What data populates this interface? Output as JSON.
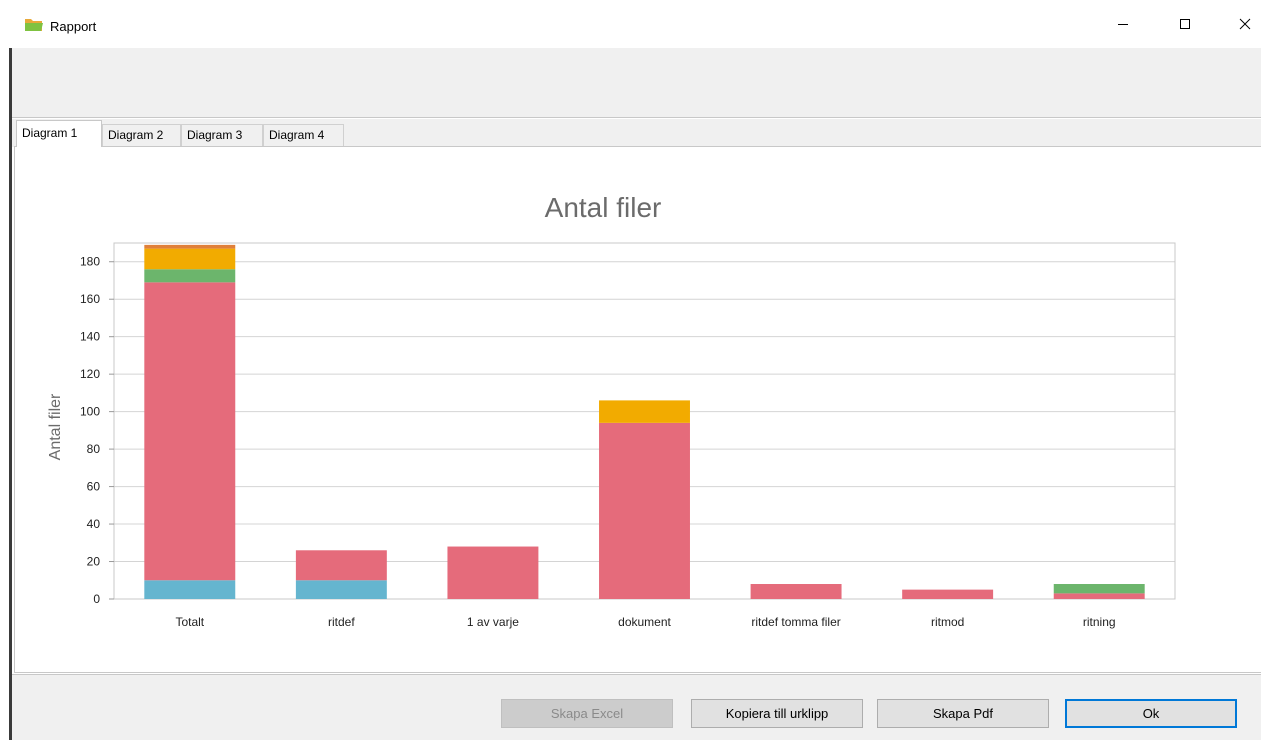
{
  "window": {
    "title": "Rapport",
    "app_icon": "folder-icon"
  },
  "tabs": [
    {
      "label": "Diagram 1",
      "active": true
    },
    {
      "label": "Diagram 2",
      "active": false
    },
    {
      "label": "Diagram 3",
      "active": false
    },
    {
      "label": "Diagram 4",
      "active": false
    }
  ],
  "buttons": {
    "excel": "Skapa Excel",
    "copy": "Kopiera till urklipp",
    "pdf": "Skapa Pdf",
    "ok": "Ok"
  },
  "colors": {
    "pink": "#e56b7b",
    "blue": "#65b5cf",
    "green": "#6cb56c",
    "yellow": "#f2ab00",
    "orange": "#e0803a",
    "accent": "#0078d7"
  },
  "chart_data": {
    "type": "bar",
    "stacked": true,
    "title": "Antal filer",
    "xlabel": "",
    "ylabel": "Antal filer",
    "ylim": [
      0,
      190
    ],
    "yticks": [
      0,
      20,
      40,
      60,
      80,
      100,
      120,
      140,
      160,
      180
    ],
    "grid": true,
    "legend": false,
    "categories": [
      "Totalt",
      "ritdef",
      "1 av varje",
      "dokument",
      "ritdef tomma filer",
      "ritmod",
      "ritning"
    ],
    "series": [
      {
        "color": "#65b5cf",
        "values": [
          10,
          10,
          0,
          0,
          0,
          0,
          0
        ]
      },
      {
        "color": "#e56b7b",
        "values": [
          159,
          16,
          28,
          94,
          8,
          5,
          3
        ]
      },
      {
        "color": "#6cb56c",
        "values": [
          7,
          0,
          0,
          0,
          0,
          0,
          5
        ]
      },
      {
        "color": "#f2ab00",
        "values": [
          11,
          0,
          0,
          12,
          0,
          0,
          0
        ]
      },
      {
        "color": "#e0803a",
        "values": [
          2,
          0,
          0,
          0,
          0,
          0,
          0
        ]
      }
    ]
  }
}
